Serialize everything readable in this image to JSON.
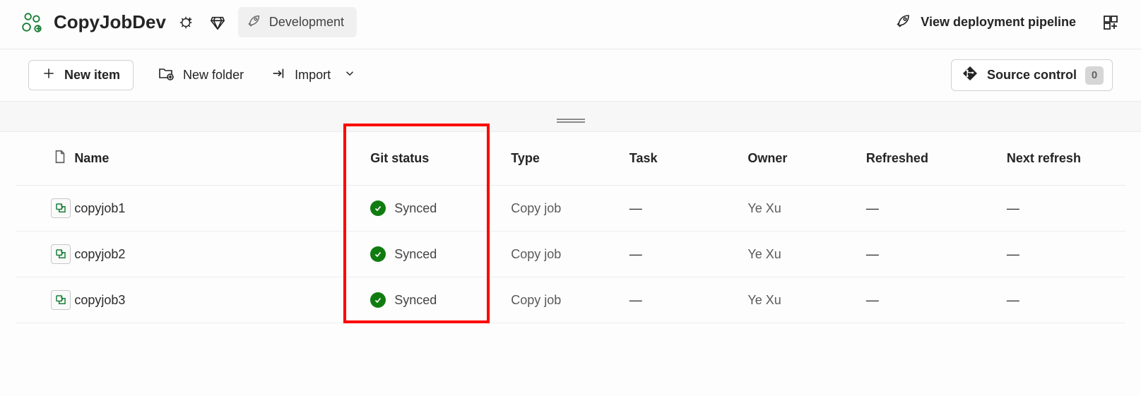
{
  "header": {
    "workspace_name": "CopyJobDev",
    "environment_label": "Development",
    "deployment_link": "View deployment pipeline"
  },
  "toolbar": {
    "new_item": "New item",
    "new_folder": "New folder",
    "import": "Import",
    "source_control": "Source control",
    "source_control_count": "0"
  },
  "columns": {
    "name": "Name",
    "git_status": "Git status",
    "type": "Type",
    "task": "Task",
    "owner": "Owner",
    "refreshed": "Refreshed",
    "next_refresh": "Next refresh"
  },
  "rows": [
    {
      "name": "copyjob1",
      "git_status": "Synced",
      "type": "Copy job",
      "task": "—",
      "owner": "Ye Xu",
      "refreshed": "—",
      "next_refresh": "—"
    },
    {
      "name": "copyjob2",
      "git_status": "Synced",
      "type": "Copy job",
      "task": "—",
      "owner": "Ye Xu",
      "refreshed": "—",
      "next_refresh": "—"
    },
    {
      "name": "copyjob3",
      "git_status": "Synced",
      "type": "Copy job",
      "task": "—",
      "owner": "Ye Xu",
      "refreshed": "—",
      "next_refresh": "—"
    }
  ],
  "highlight_column": "git_status"
}
